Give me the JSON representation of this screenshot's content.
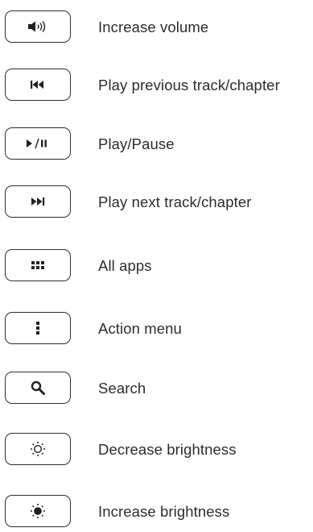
{
  "keys": [
    {
      "icon": "volume-up-icon",
      "label": "Increase volume"
    },
    {
      "icon": "previous-track-icon",
      "label": "Play previous track/chapter"
    },
    {
      "icon": "play-pause-icon",
      "label": "Play/Pause"
    },
    {
      "icon": "next-track-icon",
      "label": "Play next track/chapter"
    },
    {
      "icon": "all-apps-icon",
      "label": "All apps"
    },
    {
      "icon": "action-menu-icon",
      "label": "Action menu"
    },
    {
      "icon": "search-icon",
      "label": "Search"
    },
    {
      "icon": "brightness-down-icon",
      "label": "Decrease brightness"
    },
    {
      "icon": "brightness-up-icon",
      "label": "Increase brightness"
    }
  ]
}
